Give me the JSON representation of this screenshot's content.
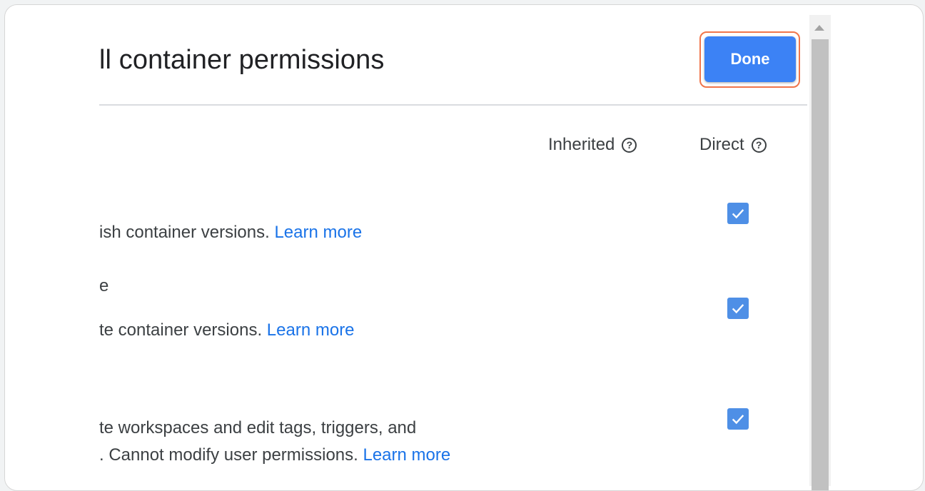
{
  "dialog": {
    "title": "ll container permissions",
    "done_label": "Done"
  },
  "columns": {
    "inherited": "Inherited",
    "direct": "Direct",
    "help_glyph": "?"
  },
  "permissions": [
    {
      "description": "ish container versions. ",
      "link": "Learn more",
      "direct_checked": true
    },
    {
      "title_fragment": "e",
      "description": "te container versions. ",
      "link": "Learn more",
      "direct_checked": true
    },
    {
      "description_line1": "te workspaces and edit tags, triggers, and",
      "description_line2": ". Cannot modify user permissions. ",
      "link": "Learn more",
      "direct_checked": true
    }
  ],
  "colors": {
    "accent": "#3c82f5",
    "highlight": "#f0754a",
    "link": "#1a73e8",
    "checkbox": "#4e8fe6"
  },
  "icons": {
    "help": "help-circle-icon",
    "check": "checkmark-icon",
    "scroll_up": "scroll-up-arrow-icon"
  }
}
